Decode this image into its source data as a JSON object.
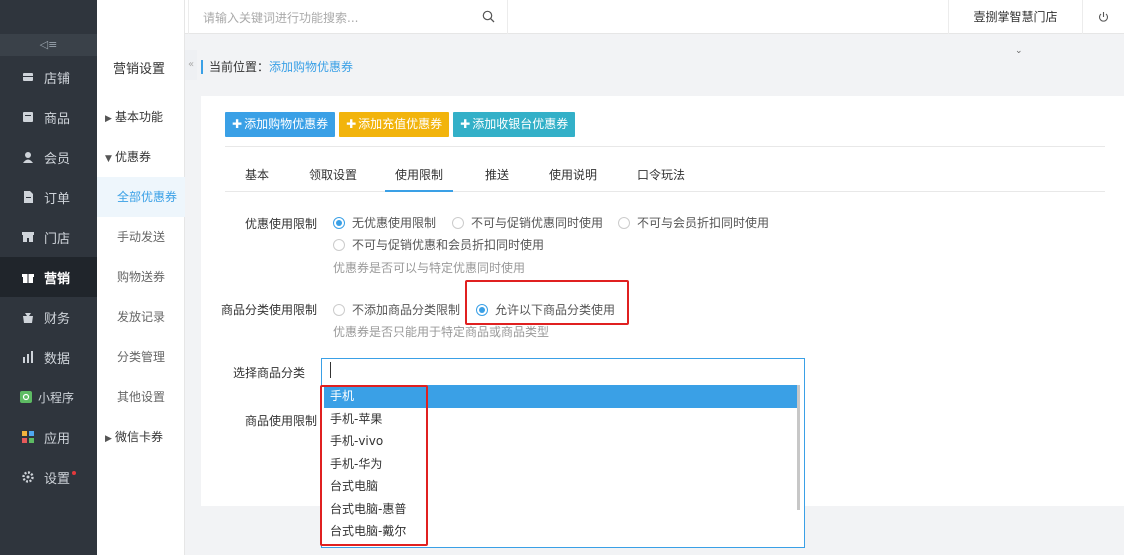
{
  "topbar": {
    "search_placeholder": "请输入关键词进行功能搜索...",
    "store_name": "壹捌掌智慧门店"
  },
  "mainnav": {
    "items": [
      {
        "label": "店铺",
        "icon": "store-icon"
      },
      {
        "label": "商品",
        "icon": "goods-icon"
      },
      {
        "label": "会员",
        "icon": "user-icon"
      },
      {
        "label": "订单",
        "icon": "order-icon"
      },
      {
        "label": "门店",
        "icon": "shop-icon"
      },
      {
        "label": "营销",
        "icon": "gift-icon"
      },
      {
        "label": "财务",
        "icon": "finance-icon"
      },
      {
        "label": "数据",
        "icon": "chart-icon"
      },
      {
        "label": "小程序",
        "icon": "miniapp-icon"
      },
      {
        "label": "应用",
        "icon": "apps-icon"
      },
      {
        "label": "设置",
        "icon": "gear-icon"
      }
    ]
  },
  "subnav": {
    "title": "营销设置",
    "items": [
      "基本功能",
      "优惠券",
      "全部优惠券",
      "手动发送",
      "购物送券",
      "发放记录",
      "分类管理",
      "其他设置",
      "微信卡券"
    ]
  },
  "breadcrumb": {
    "prefix": "当前位置：",
    "current": "添加购物优惠券"
  },
  "actions": {
    "add_shopping": "添加购物优惠券",
    "add_recharge": "添加充值优惠券",
    "add_cashier": "添加收银台优惠券"
  },
  "tabs": [
    "基本",
    "领取设置",
    "使用限制",
    "推送",
    "使用说明",
    "口令玩法"
  ],
  "form": {
    "coupon_limit_label": "优惠使用限制",
    "coupon_limit_options": [
      "无优惠使用限制",
      "不可与促销优惠同时使用",
      "不可与会员折扣同时使用",
      "不可与促销优惠和会员折扣同时使用"
    ],
    "coupon_limit_hint": "优惠券是否可以与特定优惠同时使用",
    "category_limit_label": "商品分类使用限制",
    "category_limit_options": [
      "不添加商品分类限制",
      "允许以下商品分类使用"
    ],
    "category_limit_hint": "优惠券是否只能用于特定商品或商品类型",
    "select_category_label": "选择商品分类",
    "goods_limit_label": "商品使用限制"
  },
  "dropdown_options": [
    "手机",
    "手机-苹果",
    "手机-vivo",
    "手机-华为",
    "台式电脑",
    "台式电脑-惠普",
    "台式电脑-戴尔"
  ]
}
